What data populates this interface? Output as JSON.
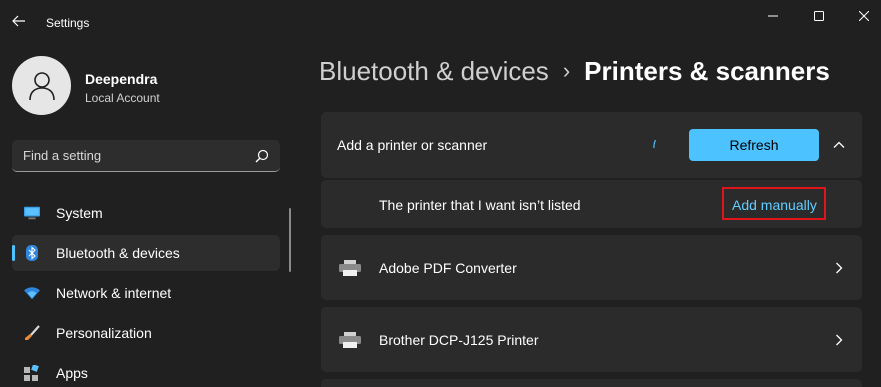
{
  "window": {
    "app_title": "Settings",
    "back_icon": "back-arrow-icon",
    "controls": [
      "minimize-icon",
      "maximize-icon",
      "close-icon"
    ]
  },
  "profile": {
    "name": "Deependra",
    "account_type": "Local Account"
  },
  "search": {
    "placeholder": "Find a setting",
    "value": ""
  },
  "nav": {
    "items": [
      {
        "label": "System",
        "icon": "monitor-icon",
        "selected": false
      },
      {
        "label": "Bluetooth & devices",
        "icon": "bluetooth-icon",
        "selected": true
      },
      {
        "label": "Network & internet",
        "icon": "wifi-icon",
        "selected": false
      },
      {
        "label": "Personalization",
        "icon": "brush-icon",
        "selected": false
      },
      {
        "label": "Apps",
        "icon": "apps-icon",
        "selected": false
      }
    ]
  },
  "header": {
    "parent": "Bluetooth & devices",
    "separator": "›",
    "current": "Printers & scanners"
  },
  "add_printer": {
    "label": "Add a printer or scanner",
    "refresh_label": "Refresh",
    "expanded": true,
    "unlisted_label": "The printer that I want isn’t listed",
    "add_manually_label": "Add manually"
  },
  "printers": [
    {
      "name": "Adobe PDF Converter",
      "icon": "printer-icon"
    },
    {
      "name": "Brother DCP-J125 Printer",
      "icon": "printer-icon"
    }
  ],
  "colors": {
    "background": "#202020",
    "card": "#2b2b2b",
    "accent": "#4cc2ff",
    "link": "#60cdff",
    "highlight_box": "#e0151b"
  }
}
